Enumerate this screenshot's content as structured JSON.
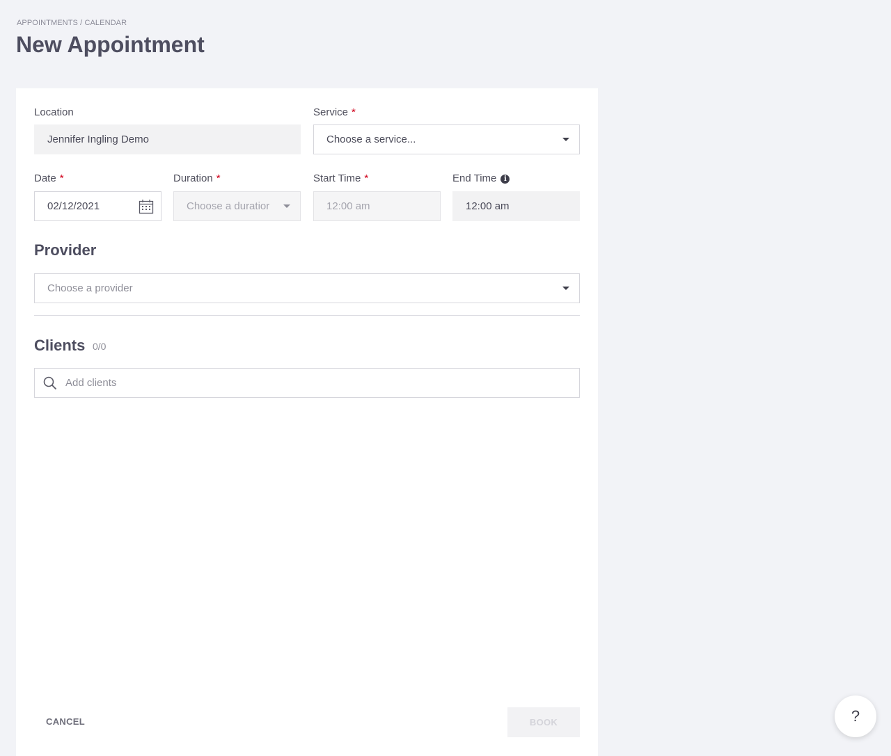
{
  "breadcrumb": "APPOINTMENTS / CALENDAR",
  "title": "New Appointment",
  "form": {
    "location": {
      "label": "Location",
      "value": "Jennifer Ingling Demo"
    },
    "service": {
      "label": "Service",
      "required": "*",
      "placeholder": "Choose a service..."
    },
    "date": {
      "label": "Date",
      "required": "*",
      "value": "02/12/2021"
    },
    "duration": {
      "label": "Duration",
      "required": "*",
      "placeholder": "Choose a duratior"
    },
    "start_time": {
      "label": "Start Time",
      "required": "*",
      "value": "12:00 am"
    },
    "end_time": {
      "label": "End Time",
      "info": "i",
      "value": "12:00 am"
    }
  },
  "provider": {
    "heading": "Provider",
    "placeholder": "Choose a provider"
  },
  "clients": {
    "heading": "Clients",
    "count": "0/0",
    "placeholder": "Add clients"
  },
  "actions": {
    "cancel": "CANCEL",
    "book": "BOOK"
  },
  "help": {
    "label": "?"
  },
  "colors": {
    "required": "#d0021b",
    "page_bg": "#f2f3f7",
    "card_bg": "#ffffff"
  },
  "icons": [
    "calendar-icon",
    "info-icon",
    "search-icon",
    "chevron-down-icon",
    "help-icon"
  ]
}
